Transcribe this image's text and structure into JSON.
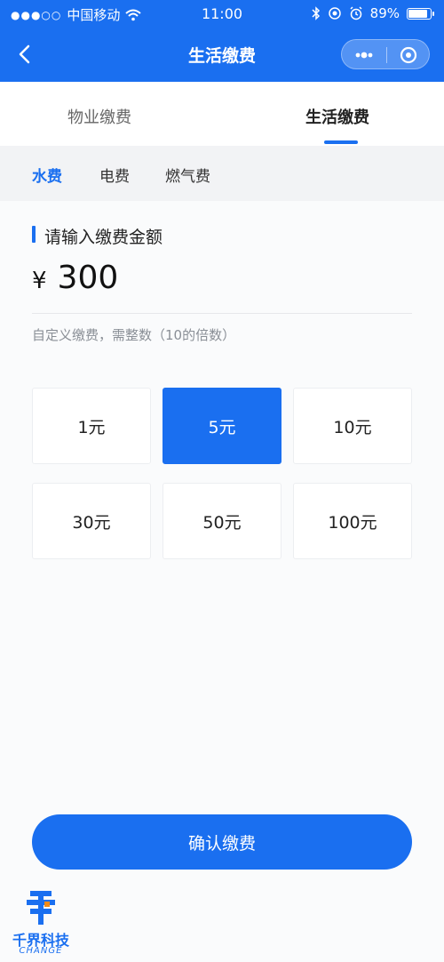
{
  "status_bar": {
    "carrier": "中国移动",
    "time": "11:00",
    "battery": "89%",
    "battery_level": 0.89
  },
  "navbar": {
    "title": "生活缴费"
  },
  "tabs": [
    {
      "label": "物业缴费",
      "active": false
    },
    {
      "label": "生活缴费",
      "active": true
    }
  ],
  "subtabs": [
    {
      "label": "水费",
      "active": true
    },
    {
      "label": "电费",
      "active": false
    },
    {
      "label": "燃气费",
      "active": false
    }
  ],
  "payment": {
    "section_title": "请输入缴费金额",
    "currency": "¥",
    "amount": "300",
    "hint": "自定义缴费，需整数（10的倍数）",
    "options": [
      {
        "label": "1元",
        "selected": false
      },
      {
        "label": "5元",
        "selected": true
      },
      {
        "label": "10元",
        "selected": false
      },
      {
        "label": "30元",
        "selected": false
      },
      {
        "label": "50元",
        "selected": false
      },
      {
        "label": "100元",
        "selected": false
      }
    ]
  },
  "confirm_label": "确认缴费",
  "watermark": {
    "text": "千界科技",
    "sub": "CHANGE"
  },
  "colors": {
    "primary": "#1a6ff0",
    "text": "#222222",
    "muted": "#8a8f96"
  }
}
